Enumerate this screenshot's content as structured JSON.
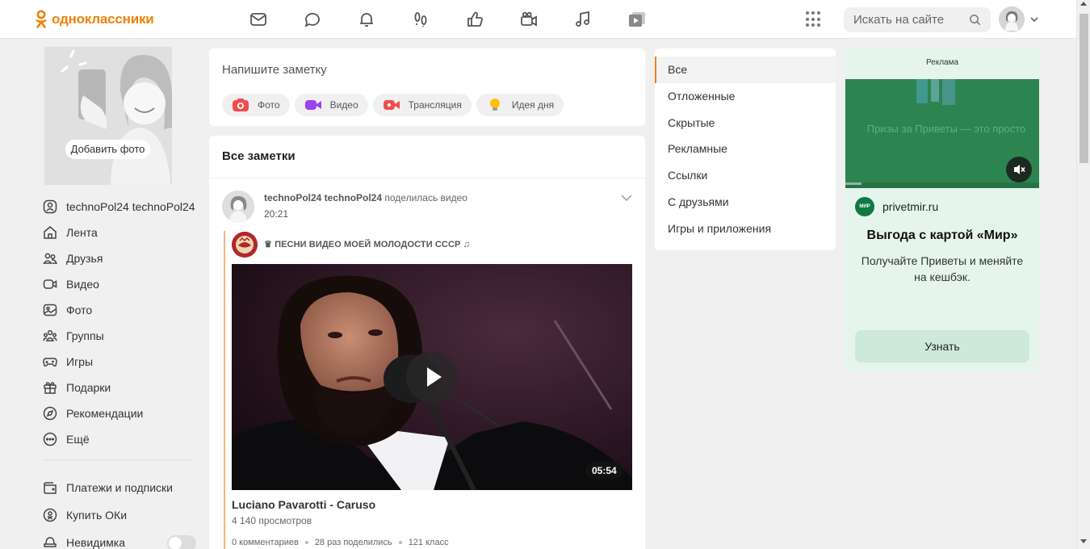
{
  "header": {
    "logo_text": "одноклассники",
    "brand_color": "#ee8208",
    "nav_icons": [
      "messages-icon",
      "discussions-icon",
      "notifications-icon",
      "guests-icon",
      "events-icon",
      "video-call-icon",
      "music-icon",
      "video-icon"
    ],
    "search_placeholder": "Искать на сайте"
  },
  "sidebar": {
    "add_photo": "Добавить фото",
    "items": [
      {
        "label": "technoPol24 technoPol24",
        "icon": "user-icon"
      },
      {
        "label": "Лента",
        "icon": "home-icon"
      },
      {
        "label": "Друзья",
        "icon": "friends-icon"
      },
      {
        "label": "Видео",
        "icon": "video-icon"
      },
      {
        "label": "Фото",
        "icon": "photo-icon"
      },
      {
        "label": "Группы",
        "icon": "groups-icon"
      },
      {
        "label": "Игры",
        "icon": "games-icon"
      },
      {
        "label": "Подарки",
        "icon": "gift-icon"
      },
      {
        "label": "Рекомендации",
        "icon": "compass-icon"
      },
      {
        "label": "Ещё",
        "icon": "more-icon"
      }
    ],
    "items2": [
      {
        "label": "Платежи и подписки",
        "icon": "wallet-icon"
      },
      {
        "label": "Купить ОКи",
        "icon": "ok-coin-icon"
      },
      {
        "label": "Невидимка",
        "icon": "invisible-icon"
      }
    ]
  },
  "compose": {
    "placeholder": "Напишите заметку",
    "actions": [
      {
        "label": "Фото",
        "icon": "camera-icon"
      },
      {
        "label": "Видео",
        "icon": "video-camera-icon"
      },
      {
        "label": "Трансляция",
        "icon": "live-stream-icon"
      },
      {
        "label": "Идея дня",
        "icon": "lightbulb-icon"
      }
    ]
  },
  "feed": {
    "title": "Все заметки",
    "post": {
      "author": "technoPol24 technoPol24",
      "action": "поделилась видео",
      "time": "20:21",
      "group_name": "♛ ПЕСНИ ВИДЕО МОЕЙ МОЛОДОСТИ СССР ♫",
      "video_duration": "05:54",
      "video_title": "Luciano Pavarotti - Caruso",
      "video_views": "4 140 просмотров",
      "comments": "0 комментариев",
      "shares": "28 раз поделились",
      "likes": "121 класс"
    }
  },
  "filters": {
    "items": [
      "Все",
      "Отложенные",
      "Скрытые",
      "Рекламные",
      "Ссылки",
      "С друзьями",
      "Игры и приложения"
    ],
    "active_index": 0
  },
  "ad": {
    "label": "Реклама",
    "media_text": "Призы за Приветы — это просто",
    "brand_logo_text": "МИР",
    "brand": "privetmir.ru",
    "title": "Выгода с картой «Мир»",
    "text": "Получайте Приветы и меняйте на кешбэк.",
    "button": "Узнать"
  }
}
